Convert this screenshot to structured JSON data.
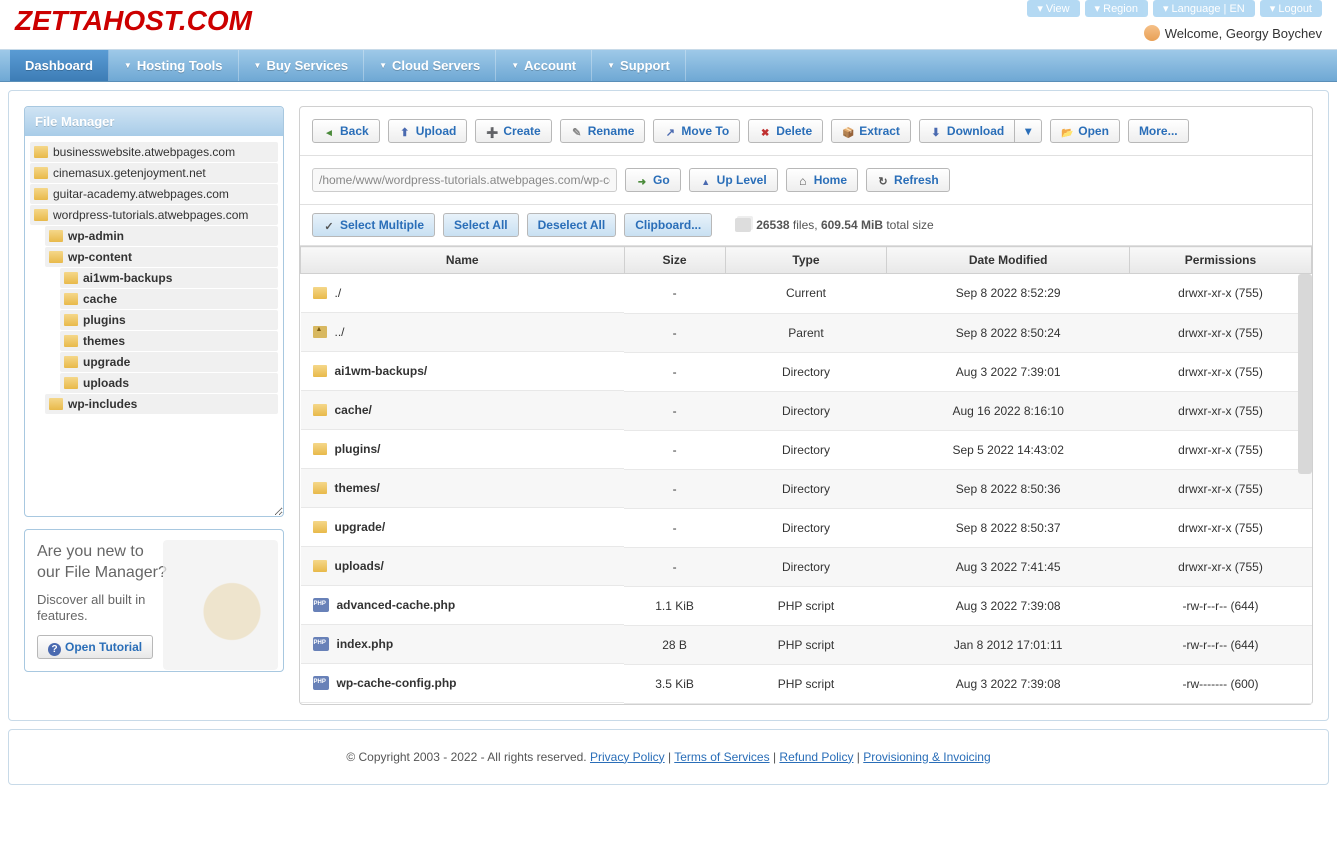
{
  "brand": "ZETTAHOST.COM",
  "topButtons": [
    "View",
    "Region",
    "Language | EN",
    "Logout"
  ],
  "welcome": "Welcome, Georgy Boychev",
  "nav": [
    {
      "label": "Dashboard",
      "dropdown": false,
      "active": true
    },
    {
      "label": "Hosting Tools",
      "dropdown": true
    },
    {
      "label": "Buy Services",
      "dropdown": true
    },
    {
      "label": "Cloud Servers",
      "dropdown": true
    },
    {
      "label": "Account",
      "dropdown": true
    },
    {
      "label": "Support",
      "dropdown": true
    }
  ],
  "panelTitle": "File Manager",
  "tree": [
    {
      "label": "businesswebsite.atwebpages.com",
      "indent": 0
    },
    {
      "label": "cinemasux.getenjoyment.net",
      "indent": 0
    },
    {
      "label": "guitar-academy.atwebpages.com",
      "indent": 0
    },
    {
      "label": "wordpress-tutorials.atwebpages.com",
      "indent": 0
    },
    {
      "label": "wp-admin",
      "indent": 1,
      "bold": true
    },
    {
      "label": "wp-content",
      "indent": 1,
      "bold": true
    },
    {
      "label": "ai1wm-backups",
      "indent": 2,
      "bold": true
    },
    {
      "label": "cache",
      "indent": 2,
      "bold": true
    },
    {
      "label": "plugins",
      "indent": 2,
      "bold": true
    },
    {
      "label": "themes",
      "indent": 2,
      "bold": true
    },
    {
      "label": "upgrade",
      "indent": 2,
      "bold": true
    },
    {
      "label": "uploads",
      "indent": 2,
      "bold": true
    },
    {
      "label": "wp-includes",
      "indent": 1,
      "bold": true
    }
  ],
  "promo": {
    "title": "Are you new to our File Manager?",
    "text": "Discover all built in features.",
    "button": "Open Tutorial"
  },
  "toolbar": {
    "back": "Back",
    "upload": "Upload",
    "create": "Create",
    "rename": "Rename",
    "move": "Move To",
    "delete": "Delete",
    "extract": "Extract",
    "download": "Download",
    "open": "Open",
    "more": "More..."
  },
  "path": "/home/www/wordpress-tutorials.atwebpages.com/wp-con",
  "pathbar": {
    "go": "Go",
    "up": "Up Level",
    "home": "Home",
    "refresh": "Refresh"
  },
  "selbar": {
    "selectMultiple": "Select Multiple",
    "selectAll": "Select All",
    "deselectAll": "Deselect All",
    "clipboard": "Clipboard..."
  },
  "stats": {
    "files": "26538",
    "filesLabel": "files,",
    "size": "609.54 MiB",
    "sizeLabel": "total size"
  },
  "headers": [
    "Name",
    "Size",
    "Type",
    "Date Modified",
    "Permissions"
  ],
  "rows": [
    {
      "icon": "folder",
      "name": "./",
      "size": "-",
      "type": "Current",
      "date": "Sep 8 2022 8:52:29",
      "perm": "drwxr-xr-x (755)"
    },
    {
      "icon": "up",
      "name": "../",
      "size": "-",
      "type": "Parent",
      "date": "Sep 8 2022 8:50:24",
      "perm": "drwxr-xr-x (755)"
    },
    {
      "icon": "folder",
      "name": "ai1wm-backups/",
      "bold": true,
      "size": "-",
      "type": "Directory",
      "date": "Aug 3 2022 7:39:01",
      "perm": "drwxr-xr-x (755)"
    },
    {
      "icon": "folder",
      "name": "cache/",
      "bold": true,
      "size": "-",
      "type": "Directory",
      "date": "Aug 16 2022 8:16:10",
      "perm": "drwxr-xr-x (755)"
    },
    {
      "icon": "folder",
      "name": "plugins/",
      "bold": true,
      "size": "-",
      "type": "Directory",
      "date": "Sep 5 2022 14:43:02",
      "perm": "drwxr-xr-x (755)"
    },
    {
      "icon": "folder",
      "name": "themes/",
      "bold": true,
      "size": "-",
      "type": "Directory",
      "date": "Sep 8 2022 8:50:36",
      "perm": "drwxr-xr-x (755)"
    },
    {
      "icon": "folder",
      "name": "upgrade/",
      "bold": true,
      "size": "-",
      "type": "Directory",
      "date": "Sep 8 2022 8:50:37",
      "perm": "drwxr-xr-x (755)"
    },
    {
      "icon": "folder",
      "name": "uploads/",
      "bold": true,
      "size": "-",
      "type": "Directory",
      "date": "Aug 3 2022 7:41:45",
      "perm": "drwxr-xr-x (755)"
    },
    {
      "icon": "php",
      "name": "advanced-cache.php",
      "bold": true,
      "size": "1.1 KiB",
      "type": "PHP script",
      "date": "Aug 3 2022 7:39:08",
      "perm": "-rw-r--r-- (644)"
    },
    {
      "icon": "php",
      "name": "index.php",
      "bold": true,
      "size": "28 B",
      "type": "PHP script",
      "date": "Jan 8 2012 17:01:11",
      "perm": "-rw-r--r-- (644)"
    },
    {
      "icon": "php",
      "name": "wp-cache-config.php",
      "bold": true,
      "size": "3.5 KiB",
      "type": "PHP script",
      "date": "Aug 3 2022 7:39:08",
      "perm": "-rw------- (600)"
    }
  ],
  "footer": {
    "copyright": "© Copyright 2003 - 2022 - All rights reserved.",
    "links": [
      "Privacy Policy",
      "Terms of Services",
      "Refund Policy",
      "Provisioning & Invoicing"
    ]
  }
}
